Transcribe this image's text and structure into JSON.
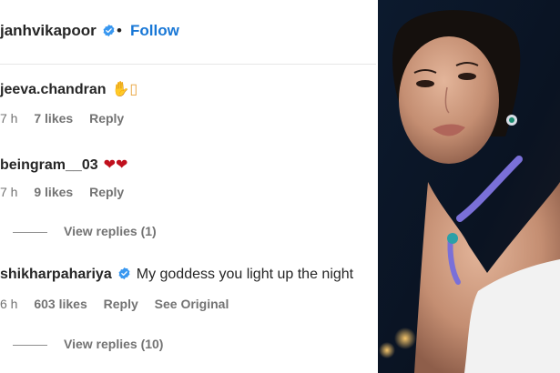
{
  "post": {
    "username": "janhvikapoor",
    "dot": "•",
    "follow_label": "Follow"
  },
  "comments": [
    {
      "username": "jeeva.chandran",
      "text": "✋▯",
      "time": "7 h",
      "likes": "7 likes",
      "reply_label": "Reply"
    },
    {
      "username": "beingram__03",
      "text": "❤❤",
      "time": "7 h",
      "likes": "9 likes",
      "reply_label": "Reply",
      "view_replies": "View replies (1)"
    },
    {
      "username": "shikharpahariya",
      "text": "My goddess you light up the night",
      "time": "6 h",
      "likes": "603 likes",
      "reply_label": "Reply",
      "see_original": "See Original",
      "view_replies": "View replies (10)"
    }
  ],
  "colors": {
    "follow": "#1877d6",
    "verified": "#3897f0",
    "heart": "#c0101d",
    "meta": "#737373"
  }
}
